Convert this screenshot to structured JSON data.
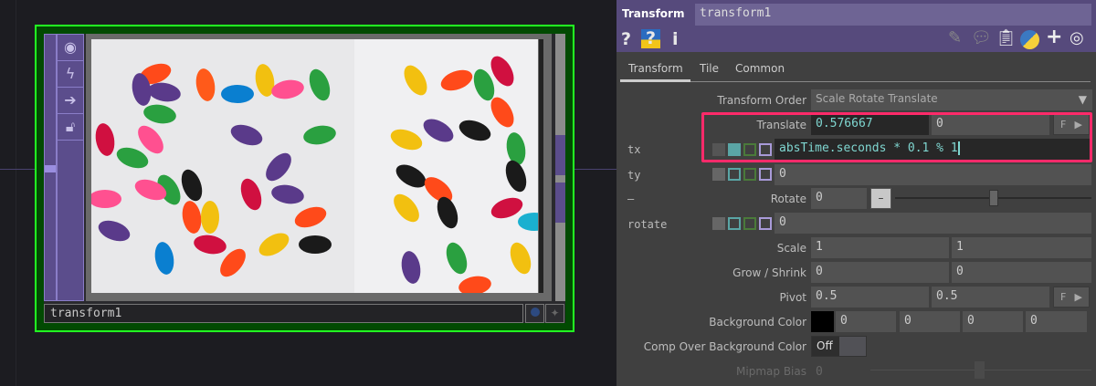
{
  "node": {
    "name": "transform1",
    "side_icons": [
      "viewer-icon",
      "bypass-icon",
      "export-icon",
      "lock-icon"
    ]
  },
  "panel": {
    "op_type": "Transform",
    "op_name": "transform1",
    "tabs": [
      "Transform",
      "Tile",
      "Common"
    ],
    "active_tab": "Transform",
    "params": {
      "transform_order": {
        "label": "Transform Order",
        "value": "Scale Rotate Translate"
      },
      "translate": {
        "label": "Translate",
        "x": "0.576667",
        "y": "0",
        "button": "F"
      },
      "tx": {
        "label": "tx",
        "expr": "absTime.seconds * 0.1 % 1"
      },
      "ty": {
        "label": "ty",
        "value": "0"
      },
      "rotate": {
        "label": "Rotate",
        "value": "0",
        "collapse": "—",
        "slider": 0.5
      },
      "rotate_expr": {
        "label": "rotate",
        "value": "0"
      },
      "scale": {
        "label": "Scale",
        "x": "1",
        "y": "1"
      },
      "grow": {
        "label": "Grow / Shrink",
        "x": "0",
        "y": "0"
      },
      "pivot": {
        "label": "Pivot",
        "x": "0.5",
        "y": "0.5",
        "button": "F"
      },
      "bg": {
        "label": "Background Color",
        "r": "0",
        "g": "0",
        "b": "0",
        "a": "0",
        "swatch": "#000000"
      },
      "comp": {
        "label": "Comp Over Background Color",
        "value": "Off"
      },
      "mipmap": {
        "label": "Mipmap Bias",
        "value": "0"
      }
    }
  },
  "colors": {
    "highlight": "#ff2a6a",
    "node_border": "#22ff22",
    "header": "#564a7c"
  }
}
